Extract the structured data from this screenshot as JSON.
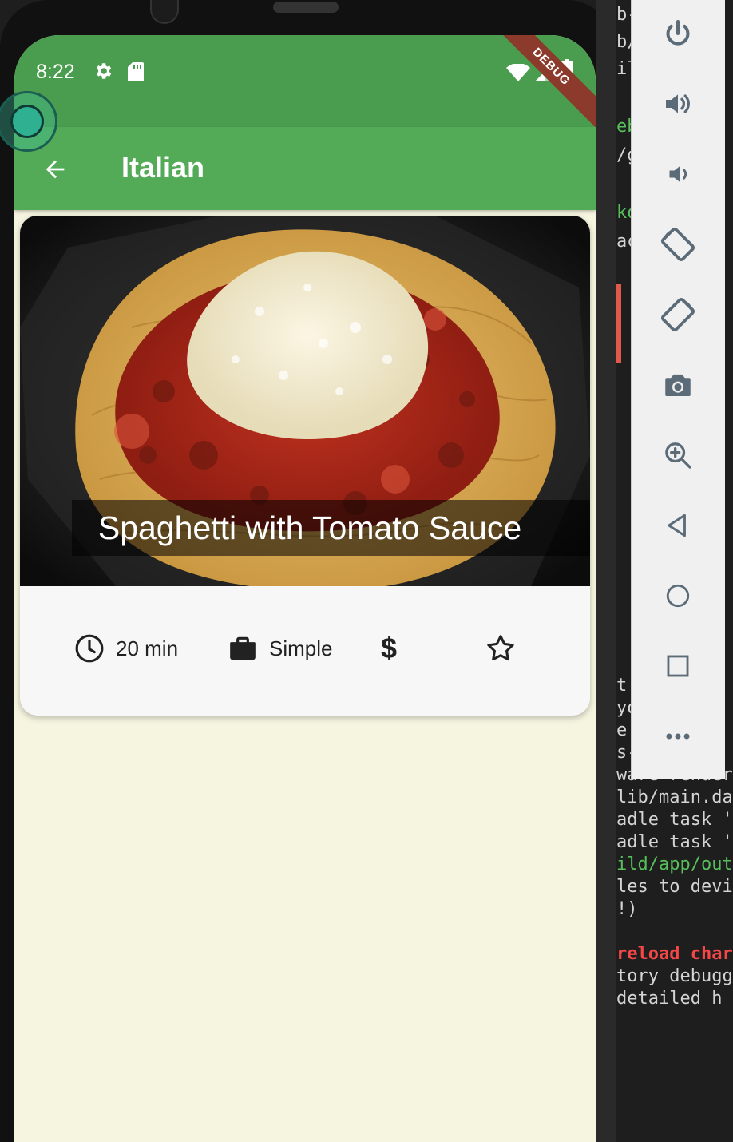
{
  "status_bar": {
    "time": "8:22",
    "debug_label": "DEBUG"
  },
  "app_bar": {
    "title": "Italian"
  },
  "meal_card": {
    "title": "Spaghetti with Tomato Sauce",
    "duration": "20 min",
    "complexity": "Simple",
    "affordability": "$"
  },
  "emulator_panel": {
    "buttons": [
      "power-icon",
      "volume-up-icon",
      "volume-down-icon",
      "rotate-left-icon",
      "rotate-right-icon",
      "camera-icon",
      "zoom-icon",
      "back-icon",
      "home-icon",
      "overview-icon",
      "more-icon"
    ]
  },
  "terminal": {
    "lines": [
      {
        "text": "b-",
        "color": "#d4d4d4"
      },
      {
        "text": "b/",
        "color": "#d4d4d4"
      },
      {
        "text": "il",
        "color": "#d4d4d4"
      },
      {
        "text": "eb",
        "color": "#57c05a"
      },
      {
        "text": "/g",
        "color": "#d4d4d4"
      },
      {
        "text": "ko",
        "color": "#57c05a"
      },
      {
        "text": "ac",
        "color": "#d4d4d4"
      },
      {
        "text": "t",
        "color": "#d4d4d4"
      },
      {
        "text": "yo",
        "color": "#d4d4d4"
      },
      {
        "text": "e",
        "color": "#d4d4d4"
      },
      {
        "text": "s-",
        "color": "#d4d4d4"
      },
      {
        "text": "ware render",
        "color": "#d4d4d4"
      },
      {
        "text": "lib/main.da",
        "color": "#d4d4d4"
      },
      {
        "text": "adle task '",
        "color": "#d4d4d4"
      },
      {
        "text": "adle task '",
        "color": "#d4d4d4"
      },
      {
        "text": "ild/app/out",
        "color": "#57c05a"
      },
      {
        "text": "les to devi",
        "color": "#d4d4d4"
      },
      {
        "text": "!)",
        "color": "#d4d4d4"
      },
      {
        "text": "reload char",
        "color": "#f44747"
      },
      {
        "text": "tory debugg",
        "color": "#d4d4d4"
      },
      {
        "text": " detailed h",
        "color": "#d4d4d4"
      }
    ]
  },
  "colors": {
    "status_bar": "#4a9d4e",
    "app_bar": "#54ab57",
    "screen_background": "#f6f5e0",
    "card": "#f7f7f7"
  }
}
